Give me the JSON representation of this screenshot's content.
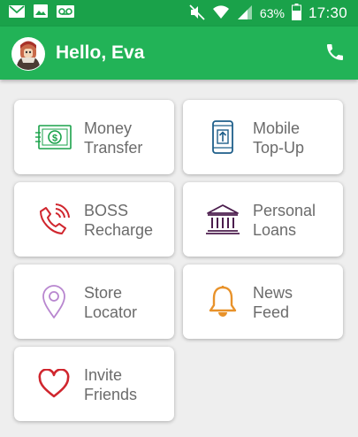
{
  "status_bar": {
    "battery_percent": "63%",
    "time": "17:30",
    "left_icons": [
      "email-icon",
      "image-icon",
      "voicemail-icon"
    ],
    "right_icons": [
      "mute-icon",
      "wifi-icon",
      "signal-icon",
      "battery-icon"
    ]
  },
  "header": {
    "greeting": "Hello, Eva",
    "avatar_icon": "avatar",
    "action_icon": "phone-icon",
    "background": "#22b357"
  },
  "menu": {
    "items": [
      {
        "line1": "Money",
        "line2": "Transfer",
        "icon": "money-icon",
        "color": "#1aa24a"
      },
      {
        "line1": "Mobile",
        "line2": "Top-Up",
        "icon": "mobile-topup-icon",
        "color": "#1f5f8a"
      },
      {
        "line1": "BOSS",
        "line2": "Recharge",
        "icon": "phone-ringing-icon",
        "color": "#d0262e"
      },
      {
        "line1": "Personal",
        "line2": "Loans",
        "icon": "bank-icon",
        "color": "#4b1d4d"
      },
      {
        "line1": "Store",
        "line2": "Locator",
        "icon": "location-pin-icon",
        "color": "#b886cf"
      },
      {
        "line1": "News",
        "line2": "Feed",
        "icon": "bell-icon",
        "color": "#e8922a"
      },
      {
        "line1": "Invite",
        "line2": "Friends",
        "icon": "heart-icon",
        "color": "#d0262e"
      }
    ]
  }
}
